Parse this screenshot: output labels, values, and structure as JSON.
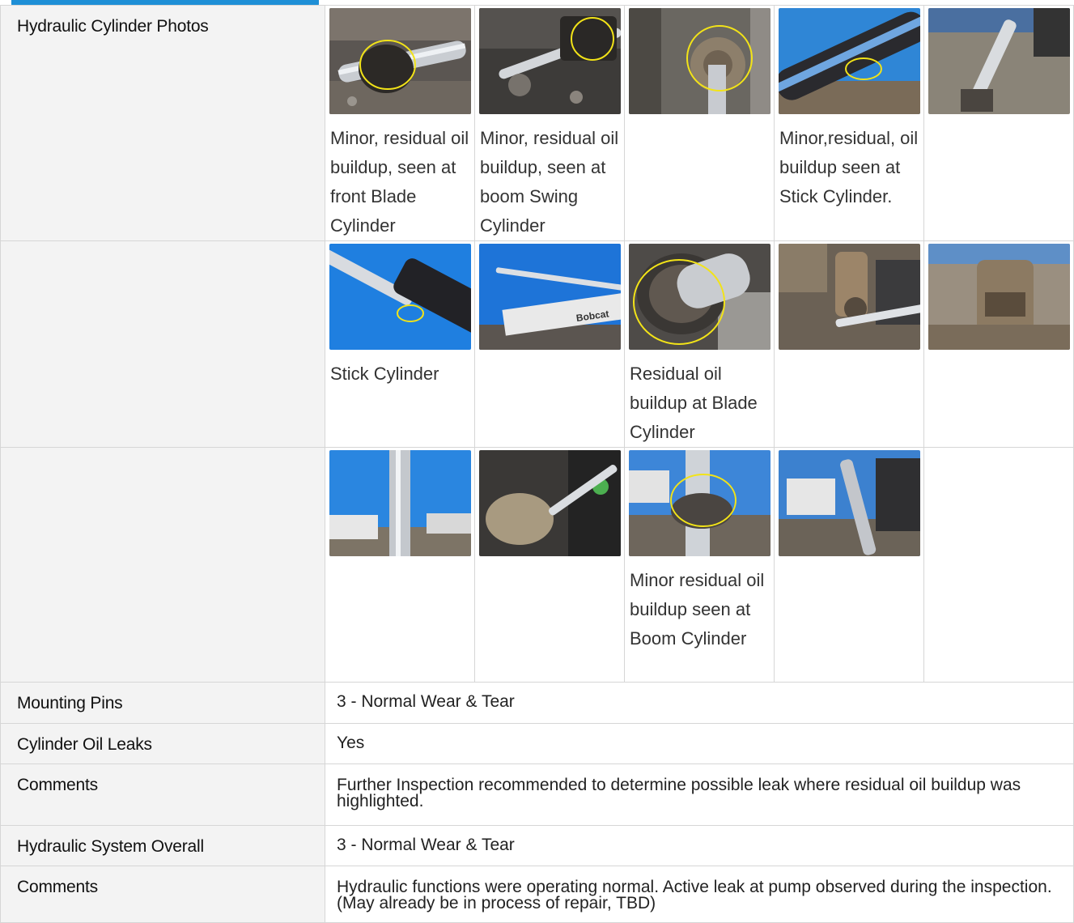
{
  "photo_section": {
    "label": "Hydraulic Cylinder Photos",
    "rows": [
      {
        "photos": [
          {
            "icon": "cylinder-photo-1",
            "caption": "Minor, residual oil buildup, seen at front Blade Cylinder"
          },
          {
            "icon": "cylinder-photo-2",
            "caption": "Minor, residual oil buildup, seen at boom Swing Cylinder"
          },
          {
            "icon": "cylinder-photo-3",
            "caption": ""
          },
          {
            "icon": "cylinder-photo-4",
            "caption": "Minor,residual, oil buildup seen at Stick Cylinder."
          },
          {
            "icon": "cylinder-photo-5",
            "caption": ""
          }
        ]
      },
      {
        "photos": [
          {
            "icon": "cylinder-photo-6",
            "caption": "Stick Cylinder"
          },
          {
            "icon": "cylinder-photo-7",
            "caption": ""
          },
          {
            "icon": "cylinder-photo-8",
            "caption": "Residual oil buildup at Blade Cylinder"
          },
          {
            "icon": "cylinder-photo-9",
            "caption": ""
          },
          {
            "icon": "cylinder-photo-10",
            "caption": ""
          }
        ]
      },
      {
        "photos": [
          {
            "icon": "cylinder-photo-11",
            "caption": ""
          },
          {
            "icon": "cylinder-photo-12",
            "caption": ""
          },
          {
            "icon": "cylinder-photo-13",
            "caption": "Minor residual oil buildup seen at Boom Cylinder"
          },
          {
            "icon": "cylinder-photo-14",
            "caption": ""
          }
        ]
      }
    ]
  },
  "fields": [
    {
      "label": "Mounting Pins",
      "value": "3 - Normal Wear & Tear"
    },
    {
      "label": "Cylinder Oil Leaks",
      "value": "Yes"
    },
    {
      "label": "Comments",
      "value": "Further Inspection recommended to determine possible leak where residual oil buildup was highlighted."
    },
    {
      "label": "Hydraulic System Overall",
      "value": "3 - Normal Wear & Tear"
    },
    {
      "label": "Comments",
      "value": "Hydraulic functions were operating normal. Active leak at pump observed during the inspection. (May already be in process of repair, TBD)"
    }
  ],
  "colors": {
    "accent": "#1E8FD6",
    "label_bg": "#f3f3f3",
    "grid": "#d6d6d6",
    "highlight_circle": "#f2e318"
  }
}
